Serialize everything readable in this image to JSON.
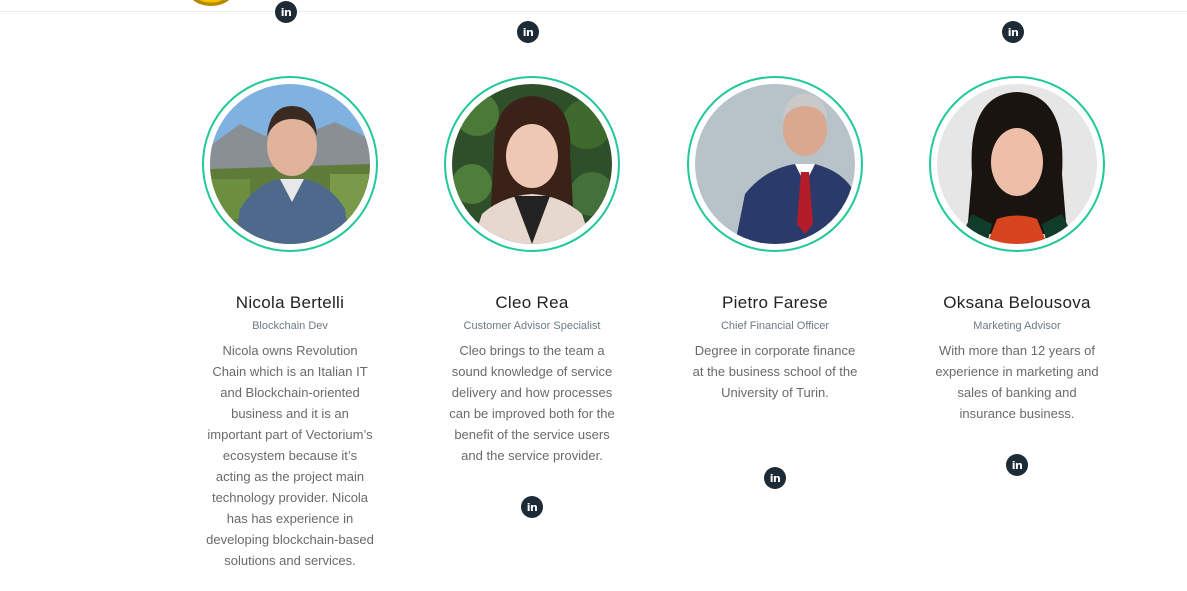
{
  "social": {
    "icon": "linkedin-icon",
    "label": "in"
  },
  "team": [
    {
      "name": "Nicola Bertelli",
      "role": "Blockchain Dev",
      "bio": "Nicola owns Revolution Chain which is an Italian IT and Blockchain-oriented business and it is an important part of Vectorium’s ecosystem because it’s acting as the project main technology provider. Nicola has has experience in developing blockchain-based solutions and services."
    },
    {
      "name": "Cleo Rea",
      "role": "Customer Advisor Specialist",
      "bio": "Cleo brings to the team a sound knowledge of service delivery and how processes can be improved both for the benefit of the service users and the service provider."
    },
    {
      "name": "Pietro Farese",
      "role": "Chief Financial Officer",
      "bio": "Degree in corporate finance at the business school of the University of Turin."
    },
    {
      "name": "Oksana Belousova",
      "role": "Marketing Advisor",
      "bio": "With more than 12 years of experience in marketing and sales of banking and insurance business."
    }
  ],
  "colors": {
    "accent": "#20c997",
    "icon_bg": "#1c2b36"
  }
}
